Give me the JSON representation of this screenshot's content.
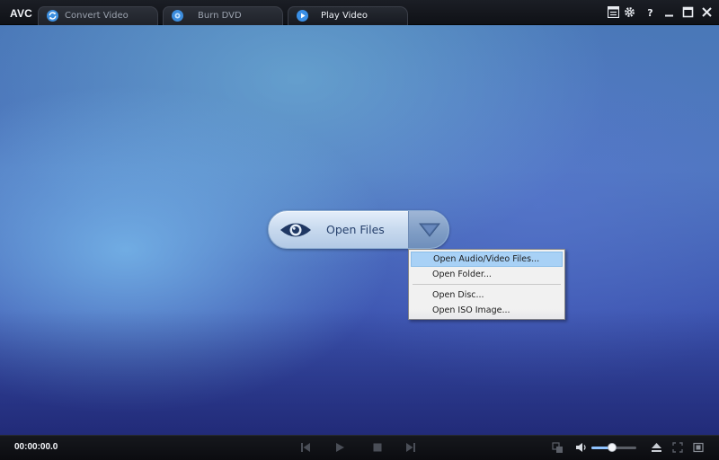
{
  "app": {
    "logo": "AVC"
  },
  "tabs": [
    {
      "label": "Convert Video",
      "icon": "convert-icon",
      "active": false
    },
    {
      "label": "Burn DVD",
      "icon": "disc-icon",
      "active": false
    },
    {
      "label": "Play Video",
      "icon": "play-circle-icon",
      "active": true
    }
  ],
  "open_button": {
    "label": "Open Files",
    "icon": "eye-icon"
  },
  "menu": {
    "items": [
      {
        "label": "Open Audio/Video Files...",
        "highlighted": true
      },
      {
        "label": "Open Folder...",
        "highlighted": false
      },
      {
        "label": "Open Disc...",
        "highlighted": false
      },
      {
        "label": "Open ISO Image...",
        "highlighted": false
      }
    ]
  },
  "player": {
    "timecode": "00:00:00.0",
    "volume_fraction": 0.46
  },
  "colors": {
    "menu_highlight": "#a8d1f6",
    "accent_blue": "#8fc3ff"
  }
}
